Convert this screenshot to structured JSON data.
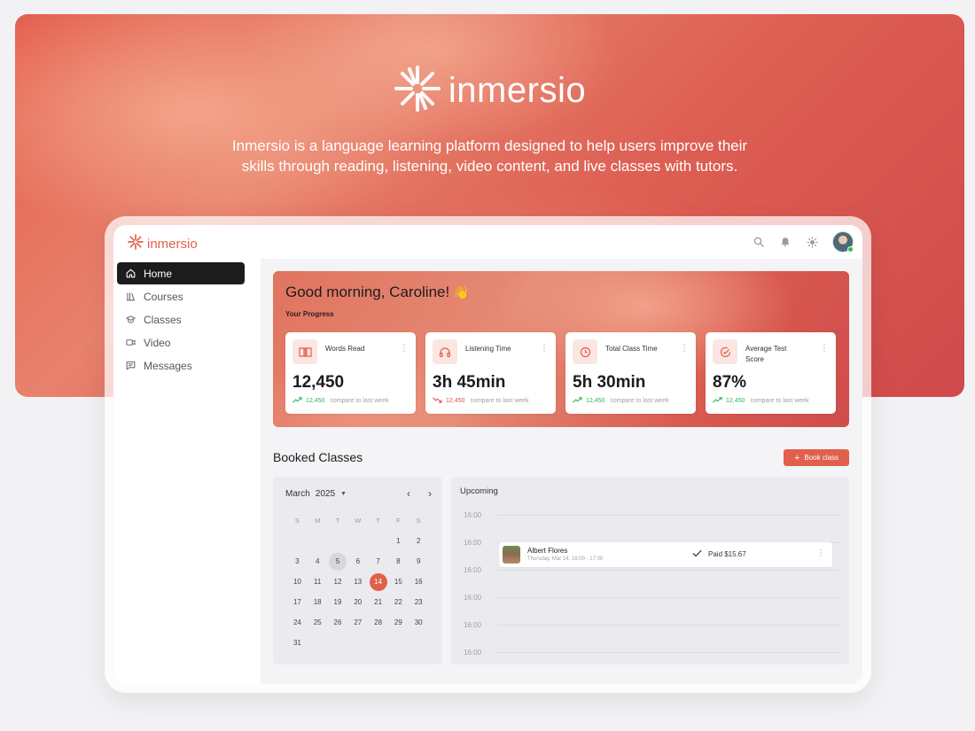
{
  "hero": {
    "brand": "inmersio",
    "tagline_line1": "Inmersio is a language learning platform designed to help users improve their",
    "tagline_line2": "skills through reading, listening, video content, and live classes with tutors."
  },
  "app": {
    "brand": "inmersio",
    "accent_color": "#e0604d",
    "top_icons": [
      "search-icon",
      "bell-icon",
      "sun-icon"
    ],
    "sidebar": {
      "items": [
        {
          "label": "Home",
          "icon": "home-icon",
          "active": true
        },
        {
          "label": "Courses",
          "icon": "library-icon"
        },
        {
          "label": "Classes",
          "icon": "graduation-cap-icon"
        },
        {
          "label": "Video",
          "icon": "video-icon"
        },
        {
          "label": "Messages",
          "icon": "message-icon"
        }
      ]
    },
    "welcome": {
      "greeting": "Good morning, Caroline!",
      "emoji": "👋",
      "progress_label": "Your Progress"
    },
    "stats": [
      {
        "label": "Words Read",
        "value": "12,450",
        "trend": "12,450",
        "direction": "up",
        "compare": "compare to last week",
        "icon": "book-icon"
      },
      {
        "label": "Listening Time",
        "value": "3h 45min",
        "trend": "12,450",
        "direction": "down",
        "compare": "compare to last week",
        "icon": "headphones-icon"
      },
      {
        "label": "Total Class Time",
        "value": "5h 30min",
        "trend": "12,450",
        "direction": "up",
        "compare": "compare to last week",
        "icon": "clock-icon"
      },
      {
        "label": "Average Test Score",
        "value": "87%",
        "trend": "12,450",
        "direction": "up",
        "compare": "compare to last week",
        "icon": "check-circle-icon"
      }
    ],
    "booked": {
      "title": "Booked Classes",
      "book_button": "Book class"
    },
    "calendar": {
      "month": "March",
      "year": "2025",
      "weekdays": [
        "S",
        "M",
        "T",
        "W",
        "T",
        "F",
        "S"
      ],
      "weeks": [
        [
          "",
          "",
          "",
          "",
          "",
          "1",
          "2"
        ],
        [
          "3",
          "4",
          "5",
          "6",
          "7",
          "8",
          "9"
        ],
        [
          "10",
          "11",
          "12",
          "13",
          "14",
          "15",
          "16"
        ],
        [
          "17",
          "18",
          "19",
          "20",
          "21",
          "22",
          "23"
        ],
        [
          "24",
          "25",
          "26",
          "27",
          "28",
          "29",
          "30"
        ],
        [
          "31",
          "",
          "",
          "",
          "",
          "",
          ""
        ]
      ],
      "today": "5",
      "selected": "14"
    },
    "upcoming": {
      "title": "Upcoming",
      "slots": [
        "16:00",
        "16:00",
        "16:00",
        "16:00",
        "16:00",
        "16:00"
      ],
      "event": {
        "name": "Albert Flores",
        "date": "Thursday, Mar 14, 16:00 - 17:00",
        "status": "Paid $15.67"
      }
    }
  }
}
